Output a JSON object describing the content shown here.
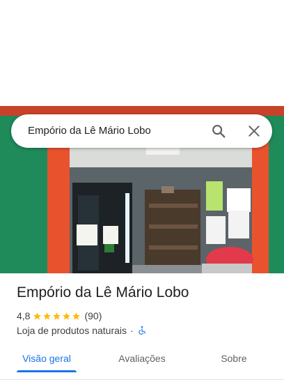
{
  "search": {
    "value": "Empório da Lê Mário Lobo"
  },
  "place": {
    "title": "Empório da Lê Mário Lobo",
    "rating": "4,8",
    "stars": 5,
    "review_count": "(90)",
    "category": "Loja de produtos naturais",
    "separator": "·"
  },
  "tabs": [
    {
      "label": "Visão geral",
      "active": true
    },
    {
      "label": "Avaliações",
      "active": false
    },
    {
      "label": "Sobre",
      "active": false
    }
  ],
  "colors": {
    "accent": "#1a73e8",
    "star": "#fbbc04",
    "storefront_green": "#1f8a5a",
    "storefront_orange": "#e8532e"
  },
  "icons": {
    "search": "search-icon",
    "close": "close-icon",
    "accessibility": "wheelchair-icon",
    "star": "star-icon"
  }
}
